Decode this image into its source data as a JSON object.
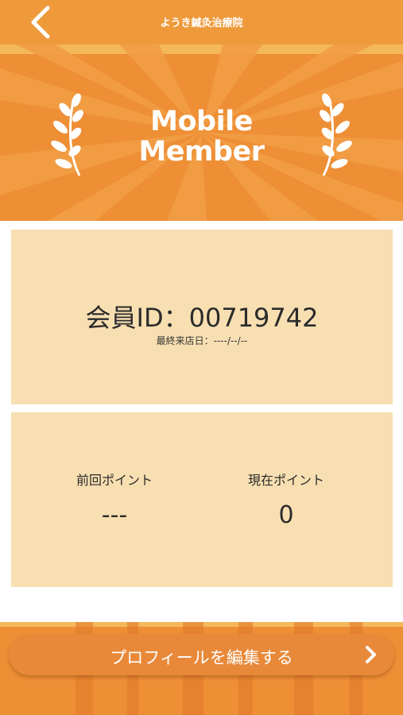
{
  "header": {
    "title": "ようき鍼灸治療院",
    "back_icon": "chevron-left-icon"
  },
  "banner": {
    "title_line1": "Mobile",
    "title_line2": "Member",
    "laurel_icon": "laurel-icon"
  },
  "member": {
    "id_label": "会員ID",
    "id_separator": "：",
    "id_value": "00719742",
    "last_visit_label": "最終来店日：",
    "last_visit_value": "----/--/--"
  },
  "points": {
    "previous_label": "前回ポイント",
    "previous_value": "---",
    "current_label": "現在ポイント",
    "current_value": "0"
  },
  "footer": {
    "edit_profile_label": "プロフィールを編集する",
    "arrow_icon": "chevron-right-icon"
  },
  "colors": {
    "header": "#EE9A3B",
    "banner": "#EE8E35",
    "card": "#F8DFB2",
    "button": "#E8893A",
    "text": "#2b2b2b"
  }
}
